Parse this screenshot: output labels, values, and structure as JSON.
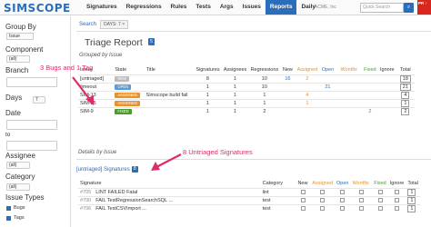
{
  "app": {
    "logo": "SIMSCOPE",
    "acme": "ACME, Inc",
    "quick_search_placeholder": "Quick Search",
    "pr_badge": "PR ↑"
  },
  "nav": [
    "Signatures",
    "Regressions",
    "Rules",
    "Tests",
    "Args",
    "Issues",
    "Reports",
    "Daily"
  ],
  "sidebar": {
    "group_by": {
      "label": "Group By",
      "value": "Issue"
    },
    "component": {
      "label": "Component",
      "value": "(all)"
    },
    "branch": {
      "label": "Branch"
    },
    "days": {
      "label": "Days",
      "value": "7"
    },
    "date": {
      "label": "Date"
    },
    "to": {
      "label": "to"
    },
    "assignee": {
      "label": "Assignee",
      "value": "(all)"
    },
    "category": {
      "label": "Category",
      "value": "(all)"
    },
    "issue_types": {
      "label": "Issue Types",
      "items": [
        "Bugs",
        "Tags"
      ]
    }
  },
  "search": {
    "label": "Search",
    "chip": "DAYS: 7 ×"
  },
  "report": {
    "title": "Triage Report",
    "count": "5",
    "grouped_by": "Grouped by Issue",
    "details_by": "Details by Issue"
  },
  "issues_table": {
    "headers": [
      "Issue",
      "State",
      "Title",
      "Signatures",
      "Assignees",
      "Regressions",
      "New",
      "Assigned",
      "Open",
      "Wontfix",
      "Fixed",
      "Ignore",
      "Total"
    ],
    "rows": [
      {
        "issue": "[untriaged]",
        "state": "NEW",
        "state_color": "#bbbbbb",
        "title": "",
        "signatures": "8",
        "assignees": "1",
        "regressions": "10",
        "new": "16",
        "assigned": "2",
        "open": "",
        "wontfix": "",
        "fixed": "",
        "ignore": "",
        "total": "18"
      },
      {
        "issue": "/imeout",
        "state": "OPEN",
        "state_color": "#5b9bd5",
        "title": "",
        "signatures": "1",
        "assignees": "1",
        "regressions": "10",
        "new": "",
        "assigned": "",
        "open": "21",
        "wontfix": "",
        "fixed": "",
        "ignore": "",
        "total": "21"
      },
      {
        "issue": "SIM-13",
        "state": "ASSIGNED",
        "state_color": "#e8912a",
        "title": "Simscope build fail",
        "signatures": "1",
        "assignees": "1",
        "regressions": "1",
        "new": "",
        "assigned": "4",
        "open": "",
        "wontfix": "",
        "fixed": "",
        "ignore": "",
        "total": "4"
      },
      {
        "issue": "SIM-25",
        "state": "ASSIGNED",
        "state_color": "#e8912a",
        "title": "",
        "signatures": "1",
        "assignees": "1",
        "regressions": "1",
        "new": "",
        "assigned": "1",
        "open": "",
        "wontfix": "",
        "fixed": "",
        "ignore": "",
        "total": "1"
      },
      {
        "issue": "SIM-9",
        "state": "FIXED",
        "state_color": "#4a9a2f",
        "title": "",
        "signatures": "1",
        "assignees": "1",
        "regressions": "2",
        "new": "",
        "assigned": "",
        "open": "",
        "wontfix": "",
        "fixed": "2",
        "ignore": "",
        "total": "2"
      }
    ]
  },
  "untriaged": {
    "label": "[untriaged] Signatures",
    "count": "8"
  },
  "sig_table": {
    "headers": [
      "Signature",
      "Category",
      "New",
      "Assigned",
      "Open",
      "Wontfix",
      "Fixed",
      "Ignore",
      "Total"
    ],
    "rows": [
      {
        "id": "#705",
        "text": "LINT FAILED Fatal",
        "category": "lint",
        "total": "1"
      },
      {
        "id": "#700",
        "text": "FAIL TestRegressionSearchSQL ...",
        "category": "test",
        "total": "1"
      },
      {
        "id": "#706",
        "text": "FAIL TestCSVImport ...",
        "category": "test",
        "total": "1"
      }
    ]
  },
  "annotations": {
    "bugs_tag": "3 Bugs and 1 Tag",
    "untriaged_sigs": "8 Untriaged Signatures"
  },
  "colors": {
    "accent": "#2a6ebb",
    "annotation": "#e02a6e"
  }
}
